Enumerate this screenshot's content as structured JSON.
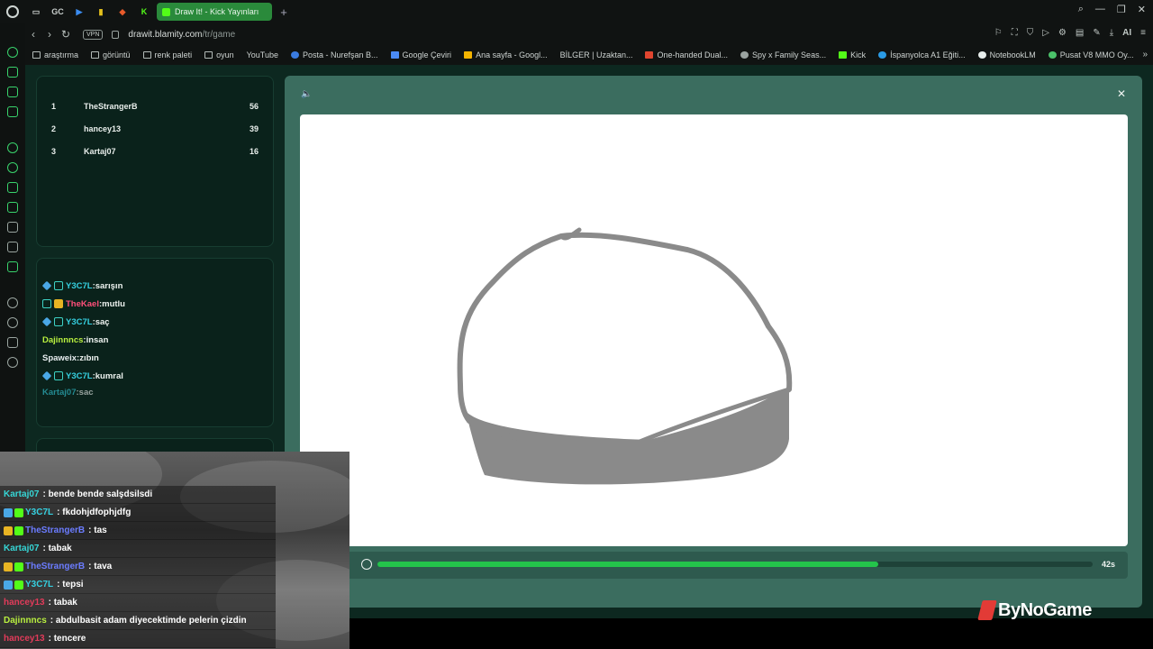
{
  "browser": {
    "pinned_tabs": [
      "GC"
    ],
    "active_tab_title": "Draw It! - Kick Yayınları",
    "new_tab_label": "+",
    "url_host": "drawit.blamity.com",
    "url_path": "/tr/game",
    "vpn_label": "VPN",
    "aria_label": "AI",
    "bookmarks": [
      "araştırma",
      "görüntü",
      "renk paleti",
      "oyun",
      "YouTube",
      "Posta - Nurefşan B...",
      "Google Çeviri",
      "Ana sayfa - Googl...",
      "BİLGER | Uzaktan...",
      "One-handed Dual...",
      "Spy x Family Seas...",
      "Kick",
      "İspanyolca A1 Eğiti...",
      "NotebookLM",
      "Pusat V8 MMO Oy..."
    ]
  },
  "leaderboard": [
    {
      "rank": "1",
      "name": "TheStrangerB",
      "score": "56"
    },
    {
      "rank": "2",
      "name": "hancey13",
      "score": "39"
    },
    {
      "rank": "3",
      "name": "Kartaj07",
      "score": "16"
    }
  ],
  "game_chat": [
    {
      "user": "Y3C7L",
      "msg": ":sarışın",
      "color": "#35d0e0"
    },
    {
      "user": "TheKael",
      "msg": ":mutlu",
      "color": "#ff4f7a"
    },
    {
      "user": "Y3C7L",
      "msg": ":saç",
      "color": "#35d0e0"
    },
    {
      "user": "Dajinnncs",
      "msg": ":insan",
      "color": "#b9f03f"
    },
    {
      "user": "Spaweix",
      "msg": ":zıbın",
      "color": "#e8eef0"
    },
    {
      "user": "Y3C7L",
      "msg": ":kumral",
      "color": "#35d0e0"
    },
    {
      "user": "Kartaj07",
      "msg": ":sac",
      "color": "#35d0e0"
    }
  ],
  "timer": {
    "remaining": "42s",
    "progress": 0.7
  },
  "brand": "ByNoGame",
  "stream_chat": [
    {
      "user": "Kartaj07",
      "msg": ": bende bende salşdsilsdi",
      "color": "#36d6d6"
    },
    {
      "user": "Y3C7L",
      "msg": ": fkdohjdfophjdfg",
      "color": "#35d0e0"
    },
    {
      "user": "TheStrangerB",
      "msg": ": tas",
      "color": "#6b7cff"
    },
    {
      "user": "Kartaj07",
      "msg": ": tabak",
      "color": "#36d6d6"
    },
    {
      "user": "TheStrangerB",
      "msg": ": tava",
      "color": "#6b7cff"
    },
    {
      "user": "Y3C7L",
      "msg": ": tepsi",
      "color": "#35d0e0"
    },
    {
      "user": "hancey13",
      "msg": ": tabak",
      "color": "#e23b5a"
    },
    {
      "user": "Dajinnncs",
      "msg": ": abdulbasit adam diyecektimde pelerin çizdin",
      "color": "#b9f03f"
    },
    {
      "user": "hancey13",
      "msg": ": tencere",
      "color": "#e23b5a"
    }
  ],
  "colors": {
    "accent": "#24c44b",
    "panel_bg": "#0a221b",
    "game_bg": "#3b6d5f"
  }
}
